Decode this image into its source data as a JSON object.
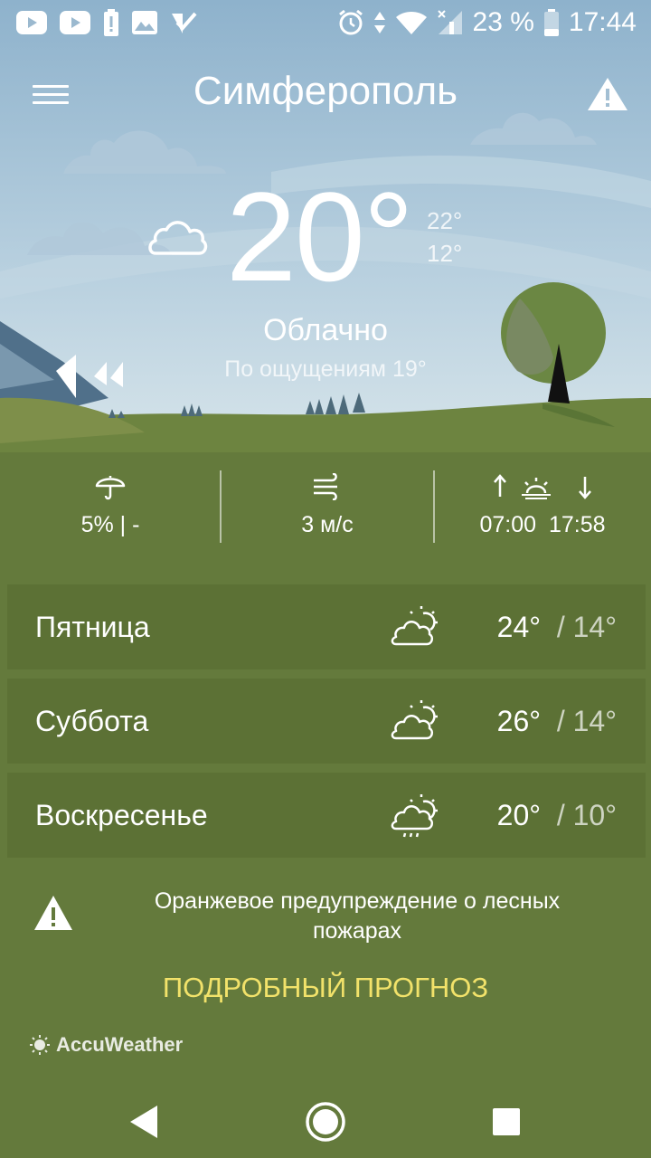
{
  "status_bar": {
    "battery_percent": "23 %",
    "time": "17:44"
  },
  "header": {
    "city": "Симферополь"
  },
  "current": {
    "temperature": "20°",
    "high": "22°",
    "low": "12°",
    "condition": "Облачно",
    "feels_like": "По ощущениям 19°"
  },
  "stats": {
    "precipitation": "5% | -",
    "wind": "3 м/с",
    "sunrise": "07:00",
    "sunset": "17:58"
  },
  "forecast": [
    {
      "day": "Пятница",
      "high": "24°",
      "low": "14°",
      "icon": "partly-cloudy-icon"
    },
    {
      "day": "Суббота",
      "high": "26°",
      "low": "14°",
      "icon": "partly-cloudy-icon"
    },
    {
      "day": "Воскресенье",
      "high": "20°",
      "low": "10°",
      "icon": "partly-cloudy-rain-icon"
    }
  ],
  "forecast_separator": "/",
  "alert": {
    "text": "Оранжевое предупреждение о лесных пожарах"
  },
  "detail_link": "ПОДРОБНЫЙ ПРОГНОЗ",
  "brand": "AccuWeather",
  "colors": {
    "ground": "#647a3c",
    "row": "#5c7135",
    "link": "#f2e26a",
    "sky_top": "#94b6cf",
    "sky_bottom": "#cfe0e9"
  }
}
